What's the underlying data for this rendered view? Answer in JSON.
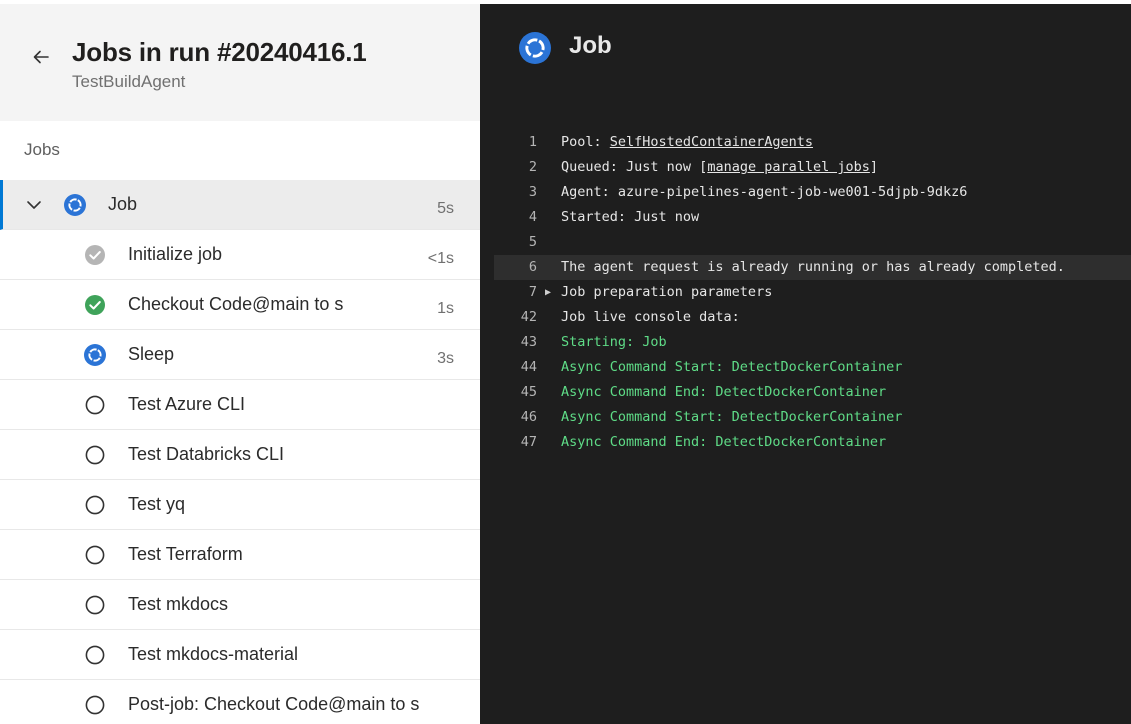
{
  "header": {
    "title": "Jobs in run #20240416.1",
    "subtitle": "TestBuildAgent"
  },
  "jobs_section_label": "Jobs",
  "job": {
    "label": "Job",
    "duration": "5s",
    "status": "running"
  },
  "steps": [
    {
      "label": "Initialize job",
      "duration": "<1s",
      "status": "skipped"
    },
    {
      "label": "Checkout Code@main to s",
      "duration": "1s",
      "status": "succeeded"
    },
    {
      "label": "Sleep",
      "duration": "3s",
      "status": "running"
    },
    {
      "label": "Test Azure CLI",
      "duration": "",
      "status": "pending"
    },
    {
      "label": "Test Databricks CLI",
      "duration": "",
      "status": "pending"
    },
    {
      "label": "Test yq",
      "duration": "",
      "status": "pending"
    },
    {
      "label": "Test Terraform",
      "duration": "",
      "status": "pending"
    },
    {
      "label": "Test mkdocs",
      "duration": "",
      "status": "pending"
    },
    {
      "label": "Test mkdocs-material",
      "duration": "",
      "status": "pending"
    },
    {
      "label": "Post-job: Checkout Code@main to s",
      "duration": "",
      "status": "pending"
    }
  ],
  "console": {
    "title": "Job",
    "lines": [
      {
        "n": "1",
        "pre": "Pool: ",
        "link": "SelfHostedContainerAgents",
        "post": ""
      },
      {
        "n": "2",
        "pre": "Queued: Just now [",
        "link": "manage parallel jobs",
        "post": "]"
      },
      {
        "n": "3",
        "text": "Agent: azure-pipelines-agent-job-we001-5djpb-9dkz6"
      },
      {
        "n": "4",
        "text": "Started: Just now"
      },
      {
        "n": "5",
        "text": ""
      },
      {
        "n": "6",
        "text": "The agent request is already running or has already completed."
      },
      {
        "n": "7",
        "text": "Job preparation parameters"
      },
      {
        "n": "42",
        "text": "Job live console data:"
      },
      {
        "n": "43",
        "text": "Starting: Job"
      },
      {
        "n": "44",
        "text": "Async Command Start: DetectDockerContainer"
      },
      {
        "n": "45",
        "text": "Async Command End: DetectDockerContainer"
      },
      {
        "n": "46",
        "text": "Async Command Start: DetectDockerContainer"
      },
      {
        "n": "47",
        "text": "Async Command End: DetectDockerContainer"
      }
    ]
  },
  "colors": {
    "accent": "#0078d4",
    "running": "#2b74d6",
    "succeeded": "#3fa35a",
    "skipped": "#b5b5b5",
    "console_green": "#5fdc87"
  }
}
